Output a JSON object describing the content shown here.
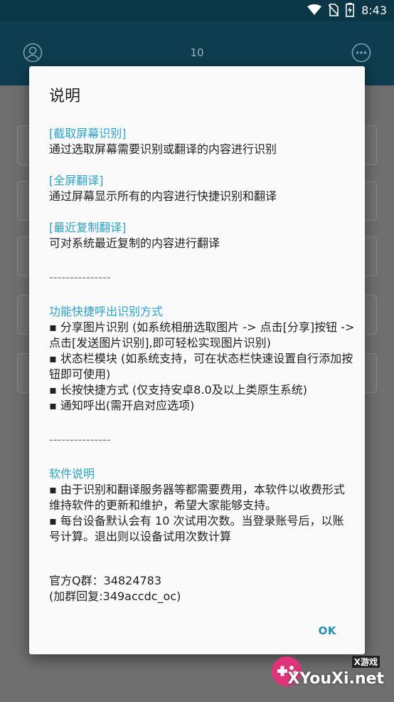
{
  "statusbar": {
    "time": "8:43"
  },
  "appbar": {
    "count": "10"
  },
  "dialog": {
    "title": "说明",
    "sections": [
      {
        "heading": "[截取屏幕识别]",
        "lines": [
          "通过选取屏幕需要识别或翻译的内容进行识别"
        ]
      },
      {
        "heading": "[全屏翻译]",
        "lines": [
          "通过屏幕显示所有的内容进行快捷识别和翻译"
        ]
      },
      {
        "heading": "[最近复制翻译]",
        "lines": [
          "可对系统最近复制的内容进行翻译"
        ]
      }
    ],
    "separator1": "---------------",
    "shortcut": {
      "heading": "功能快捷呼出识别方式",
      "lines": [
        "▪ 分享图片识别 (如系统相册选取图片 -> 点击[分享]按钮 -> 点击[发送图片识别],即可轻松实现图片识别)",
        "▪ 状态栏模块 (如系统支持，可在状态栏快速设置自行添加按钮即可使用)",
        "▪ 长按快捷方式 (仅支持安卓8.0及以上类原生系统)",
        "▪ 通知呼出(需开启对应选项)"
      ]
    },
    "separator2": "---------------",
    "software": {
      "heading": "软件说明",
      "lines": [
        "▪ 由于识别和翻译服务器等都需要费用，本软件以收费形式维持软件的更新和维护，希望大家能够支持。",
        "▪ 每台设备默认会有 10 次试用次数。当登录账号后，以账号计算。退出则以设备试用次数计算"
      ]
    },
    "qq_group": "官方Q群：34824783",
    "qq_reply": "(加群回复:349accdc_oc)",
    "ok_label": "OK"
  },
  "watermark": {
    "site": "XYouXi.net",
    "tag": "X游戏"
  }
}
